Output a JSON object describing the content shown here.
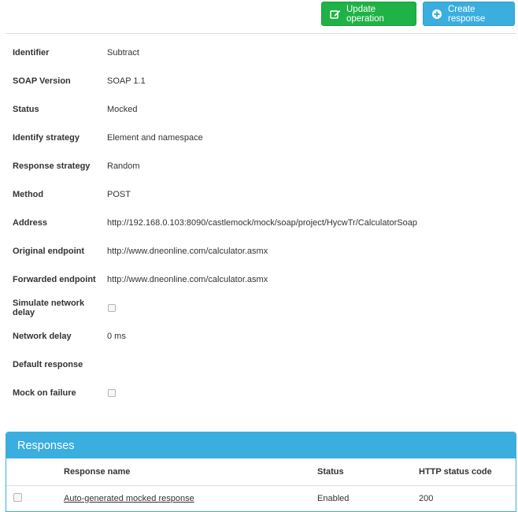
{
  "toolbar": {
    "update_label": "Update operation",
    "update_icon": "edit-icon",
    "update_color": "#1fb246",
    "create_label": "Create response",
    "create_icon": "plus-circle-icon",
    "create_color": "#3aaede"
  },
  "properties": [
    {
      "label": "Identifier",
      "value": "Subtract"
    },
    {
      "label": "SOAP Version",
      "value": "SOAP 1.1"
    },
    {
      "label": "Status",
      "value": "Mocked"
    },
    {
      "label": "Identify strategy",
      "value": "Element and namespace"
    },
    {
      "label": "Response strategy",
      "value": "Random"
    },
    {
      "label": "Method",
      "value": "POST"
    },
    {
      "label": "Address",
      "value": "http://192.168.0.103:8090/castlemock/mock/soap/project/HycwTr/CalculatorSoap"
    },
    {
      "label": "Original endpoint",
      "value": "http://www.dneonline.com/calculator.asmx"
    },
    {
      "label": "Forwarded endpoint",
      "value": "http://www.dneonline.com/calculator.asmx"
    },
    {
      "label": "Simulate network delay",
      "checked": false
    },
    {
      "label": "Network delay",
      "value": "0 ms"
    },
    {
      "label": "Default response",
      "value": ""
    },
    {
      "label": "Mock on failure",
      "checked": false
    }
  ],
  "responses": {
    "title": "Responses",
    "accent_color": "#3aaede",
    "columns": {
      "name": "Response name",
      "status": "Status",
      "code": "HTTP status code"
    },
    "rows": [
      {
        "name": "Auto-generated mocked response",
        "status": "Enabled",
        "code": "200",
        "checked": false
      }
    ]
  }
}
